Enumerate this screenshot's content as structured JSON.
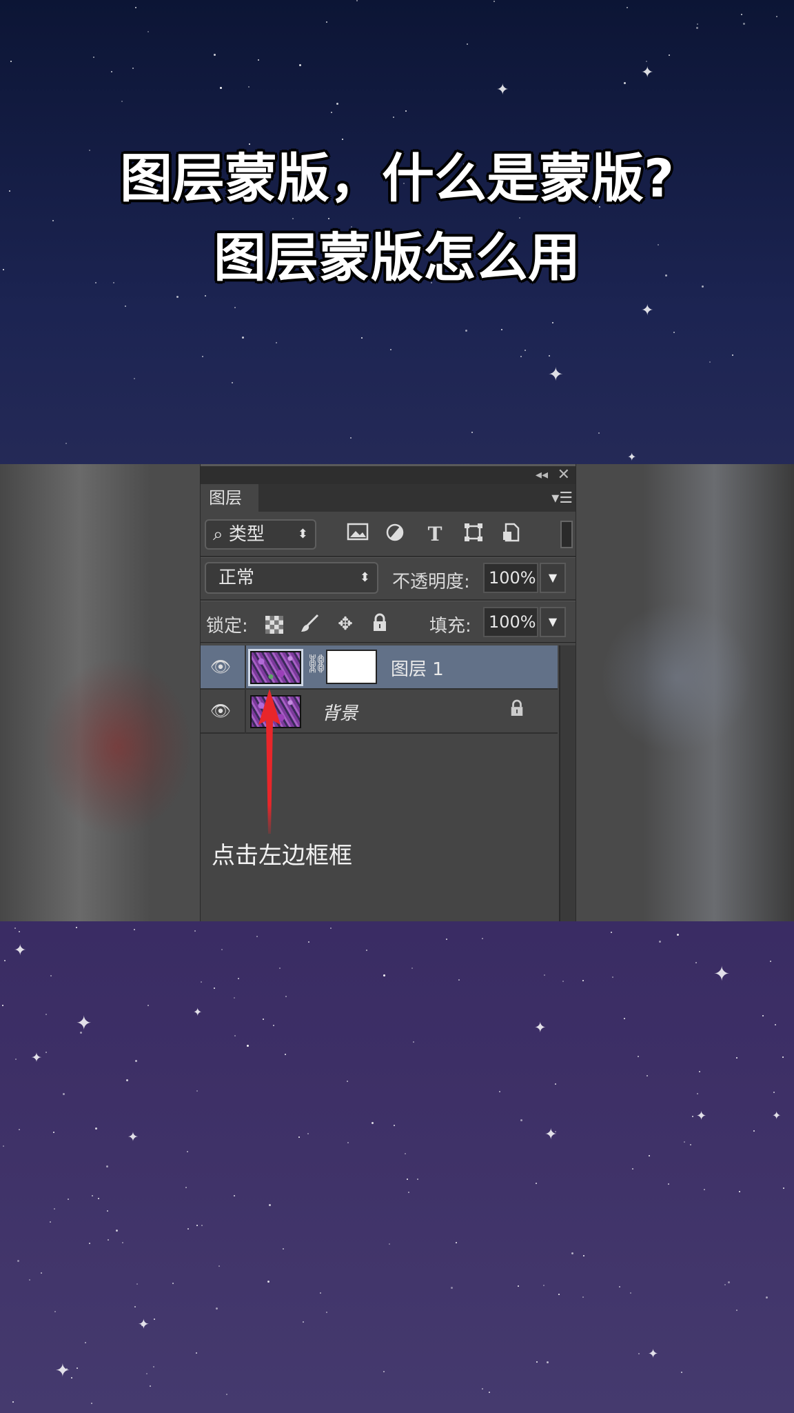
{
  "title": {
    "line1": "图层蒙版，什么是蒙版?",
    "line2": "图层蒙版怎么用"
  },
  "panel": {
    "collapse_icon": "◂◂",
    "close_icon": "✕",
    "tab_label": "图层",
    "menu_icon": "▾☰",
    "filter": {
      "kind_label": "类型",
      "icons": [
        "image-filter-icon",
        "adjustment-filter-icon",
        "type-filter-icon",
        "shape-filter-icon",
        "smart-object-filter-icon"
      ]
    },
    "blend_mode": "正常",
    "opacity_label": "不透明度:",
    "opacity_value": "100%",
    "lock_label": "锁定:",
    "fill_label": "填充:",
    "fill_value": "100%",
    "layers": [
      {
        "name": "图层 1",
        "selected": true,
        "has_mask": true
      },
      {
        "name": "背景",
        "selected": false,
        "locked": true
      }
    ],
    "annotation": "点击左边框框"
  },
  "colors": {
    "arrow": "#e8262a",
    "selected_layer": "#627188",
    "panel_bg": "#454545"
  }
}
